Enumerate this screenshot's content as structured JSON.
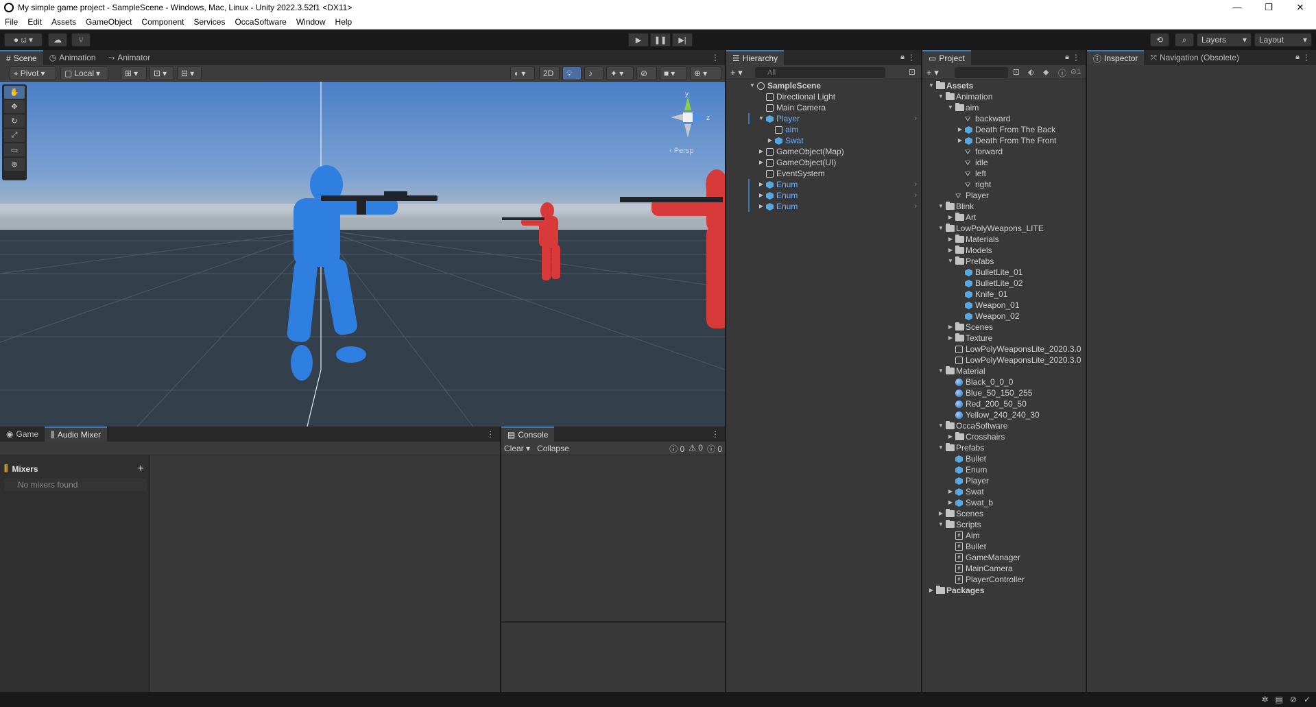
{
  "window": {
    "title": "My simple game project - SampleScene - Windows, Mac, Linux - Unity 2022.3.52f1 <DX11>",
    "controls": [
      "—",
      "❐",
      "✕"
    ]
  },
  "menu": [
    "File",
    "Edit",
    "Assets",
    "GameObject",
    "Component",
    "Services",
    "OccaSoftware",
    "Window",
    "Help"
  ],
  "toolbar": {
    "account_label": "ಚ",
    "layers_label": "Layers",
    "layout_label": "Layout"
  },
  "scene_panel": {
    "tabs": [
      {
        "label": "Scene",
        "icon": "grid-icon"
      },
      {
        "label": "Animation",
        "icon": "clock-icon"
      },
      {
        "label": "Animator",
        "icon": "animator-icon"
      }
    ],
    "pivot_label": "Pivot",
    "local_label": "Local",
    "mode_2d_label": "2D",
    "persp_label": "‹ Persp",
    "gizmo_axes": {
      "y": "y",
      "z": "z"
    }
  },
  "game_panel": {
    "tabs": [
      {
        "label": "Game",
        "icon": "gamepad-icon"
      },
      {
        "label": "Audio Mixer",
        "icon": "mixer-icon"
      }
    ],
    "mixers_title": "Mixers",
    "mixers_empty": "No mixers found"
  },
  "console_panel": {
    "tab_label": "Console",
    "clear_label": "Clear",
    "collapse_label": "Collapse",
    "counts": {
      "info": "0",
      "warnings": "0",
      "errors": "0"
    }
  },
  "hierarchy": {
    "tab_label": "Hierarchy",
    "search_placeholder": "All",
    "rows": [
      {
        "label": "SampleScene",
        "depth": 0,
        "expanded": true,
        "icon": "scene",
        "bold": true
      },
      {
        "label": "Directional Light",
        "depth": 1,
        "icon": "gameobject"
      },
      {
        "label": "Main Camera",
        "depth": 1,
        "icon": "gameobject"
      },
      {
        "label": "Player",
        "depth": 1,
        "expanded": true,
        "icon": "prefab",
        "blue": true,
        "arrow": true
      },
      {
        "label": "aim",
        "depth": 2,
        "icon": "gameobject",
        "blue": true
      },
      {
        "label": "Swat",
        "depth": 2,
        "collapsed": true,
        "icon": "prefab",
        "blue": true
      },
      {
        "label": "GameObject(Map)",
        "depth": 1,
        "collapsed": true,
        "icon": "gameobject"
      },
      {
        "label": "GameObject(UI)",
        "depth": 1,
        "collapsed": true,
        "icon": "gameobject"
      },
      {
        "label": "EventSystem",
        "depth": 1,
        "icon": "gameobject"
      },
      {
        "label": "Enum",
        "depth": 1,
        "collapsed": true,
        "icon": "prefab",
        "blue": true,
        "arrow": true
      },
      {
        "label": "Enum",
        "depth": 1,
        "collapsed": true,
        "icon": "prefab",
        "blue": true,
        "arrow": true
      },
      {
        "label": "Enum",
        "depth": 1,
        "collapsed": true,
        "icon": "prefab",
        "blue": true,
        "arrow": true
      }
    ]
  },
  "project": {
    "tab_label": "Project",
    "hidden_count": "1",
    "rows": [
      {
        "label": "Assets",
        "depth": 0,
        "expanded": true,
        "icon": "folder",
        "bold": true
      },
      {
        "label": "Animation",
        "depth": 1,
        "expanded": true,
        "icon": "folder"
      },
      {
        "label": "aim",
        "depth": 2,
        "expanded": true,
        "icon": "folder"
      },
      {
        "label": "backward",
        "depth": 3,
        "icon": "anim"
      },
      {
        "label": "Death From The Back",
        "depth": 3,
        "collapsed": true,
        "icon": "prefab"
      },
      {
        "label": "Death From The Front",
        "depth": 3,
        "collapsed": true,
        "icon": "prefab"
      },
      {
        "label": "forward",
        "depth": 3,
        "icon": "anim"
      },
      {
        "label": "idle",
        "depth": 3,
        "icon": "anim"
      },
      {
        "label": "left",
        "depth": 3,
        "icon": "anim"
      },
      {
        "label": "right",
        "depth": 3,
        "icon": "anim"
      },
      {
        "label": "Player",
        "depth": 2,
        "icon": "animator"
      },
      {
        "label": "Blink",
        "depth": 1,
        "expanded": true,
        "icon": "folder"
      },
      {
        "label": "Art",
        "depth": 2,
        "collapsed": true,
        "icon": "folder"
      },
      {
        "label": "LowPolyWeapons_LITE",
        "depth": 1,
        "expanded": true,
        "icon": "folder"
      },
      {
        "label": "Materials",
        "depth": 2,
        "collapsed": true,
        "icon": "folder"
      },
      {
        "label": "Models",
        "depth": 2,
        "collapsed": true,
        "icon": "folder"
      },
      {
        "label": "Prefabs",
        "depth": 2,
        "expanded": true,
        "icon": "folder"
      },
      {
        "label": "BulletLite_01",
        "depth": 3,
        "icon": "prefab"
      },
      {
        "label": "BulletLite_02",
        "depth": 3,
        "icon": "prefab"
      },
      {
        "label": "Knife_01",
        "depth": 3,
        "icon": "prefab"
      },
      {
        "label": "Weapon_01",
        "depth": 3,
        "icon": "prefab"
      },
      {
        "label": "Weapon_02",
        "depth": 3,
        "icon": "prefab"
      },
      {
        "label": "Scenes",
        "depth": 2,
        "collapsed": true,
        "icon": "folder"
      },
      {
        "label": "Texture",
        "depth": 2,
        "collapsed": true,
        "icon": "folder"
      },
      {
        "label": "LowPolyWeaponsLite_2020.3.0",
        "depth": 2,
        "icon": "unityobj"
      },
      {
        "label": "LowPolyWeaponsLite_2020.3.0",
        "depth": 2,
        "icon": "unityobj"
      },
      {
        "label": "Material",
        "depth": 1,
        "expanded": true,
        "icon": "folder"
      },
      {
        "label": "Black_0_0_0",
        "depth": 2,
        "icon": "material"
      },
      {
        "label": "Blue_50_150_255",
        "depth": 2,
        "icon": "material"
      },
      {
        "label": "Red_200_50_50",
        "depth": 2,
        "icon": "material"
      },
      {
        "label": "Yellow_240_240_30",
        "depth": 2,
        "icon": "material"
      },
      {
        "label": "OccaSoftware",
        "depth": 1,
        "expanded": true,
        "icon": "folder"
      },
      {
        "label": "Crosshairs",
        "depth": 2,
        "collapsed": true,
        "icon": "folder"
      },
      {
        "label": "Prefabs",
        "depth": 1,
        "expanded": true,
        "icon": "folder"
      },
      {
        "label": "Bullet",
        "depth": 2,
        "icon": "prefab"
      },
      {
        "label": "Enum",
        "depth": 2,
        "icon": "prefab"
      },
      {
        "label": "Player",
        "depth": 2,
        "icon": "prefab"
      },
      {
        "label": "Swat",
        "depth": 2,
        "collapsed": true,
        "icon": "prefab"
      },
      {
        "label": "Swat_b",
        "depth": 2,
        "collapsed": true,
        "icon": "prefab"
      },
      {
        "label": "Scenes",
        "depth": 1,
        "collapsed": true,
        "icon": "folder"
      },
      {
        "label": "Scripts",
        "depth": 1,
        "expanded": true,
        "icon": "folder"
      },
      {
        "label": "Aim",
        "depth": 2,
        "icon": "script"
      },
      {
        "label": "Bullet",
        "depth": 2,
        "icon": "script"
      },
      {
        "label": "GameManager",
        "depth": 2,
        "icon": "script"
      },
      {
        "label": "MainCamera",
        "depth": 2,
        "icon": "script"
      },
      {
        "label": "PlayerController",
        "depth": 2,
        "icon": "script"
      },
      {
        "label": "Packages",
        "depth": 0,
        "collapsed": true,
        "icon": "folder",
        "bold": true
      }
    ]
  },
  "inspector": {
    "tabs": [
      {
        "label": "Inspector",
        "icon": "info-icon"
      },
      {
        "label": "Navigation (Obsolete)",
        "icon": "navigation-icon"
      }
    ]
  },
  "colors": {
    "player_blue": "#2f7fe0",
    "enemy_red": "#d83a3a",
    "accent": "#3a79bb",
    "prefab_text": "#6fb0ff"
  }
}
